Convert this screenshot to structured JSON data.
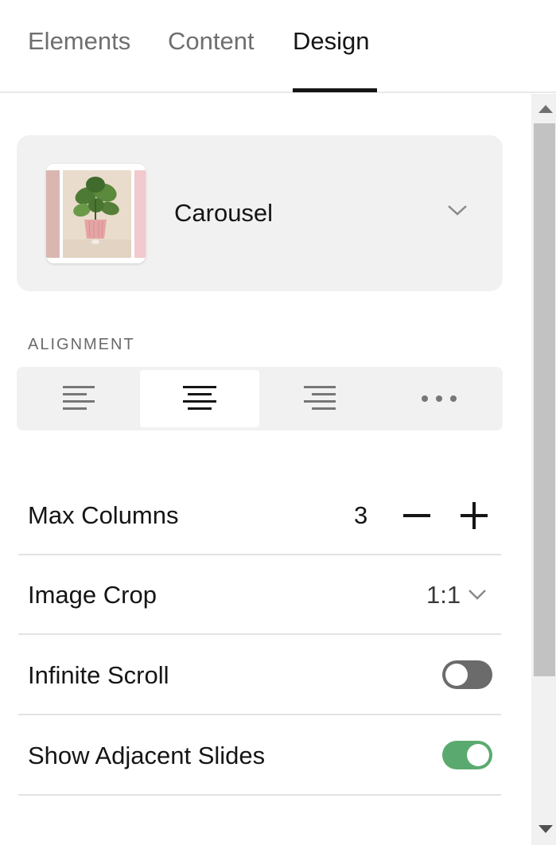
{
  "tabs": [
    {
      "label": "Elements",
      "active": false
    },
    {
      "label": "Content",
      "active": false
    },
    {
      "label": "Design",
      "active": true
    }
  ],
  "layout": {
    "label": "Carousel",
    "chevron_icon": "chevron-down-icon",
    "thumbnail_icon": "carousel-layout-thumbnail"
  },
  "alignment": {
    "label": "ALIGNMENT",
    "options": [
      {
        "name": "align-left-icon",
        "selected": false
      },
      {
        "name": "align-center-icon",
        "selected": true
      },
      {
        "name": "align-right-icon",
        "selected": false
      },
      {
        "name": "more-options-icon",
        "selected": false
      }
    ]
  },
  "settings": {
    "max_columns": {
      "label": "Max Columns",
      "value": "3",
      "decrement_icon": "minus-icon",
      "increment_icon": "plus-icon"
    },
    "image_crop": {
      "label": "Image Crop",
      "value": "1:1"
    },
    "infinite_scroll": {
      "label": "Infinite Scroll",
      "enabled": false
    },
    "show_adjacent_slides": {
      "label": "Show Adjacent Slides",
      "enabled": true
    }
  },
  "colors": {
    "accent_on": "#5aaa6f",
    "toggle_off": "#6b6b6b",
    "card_bg": "#f1f1f1"
  }
}
